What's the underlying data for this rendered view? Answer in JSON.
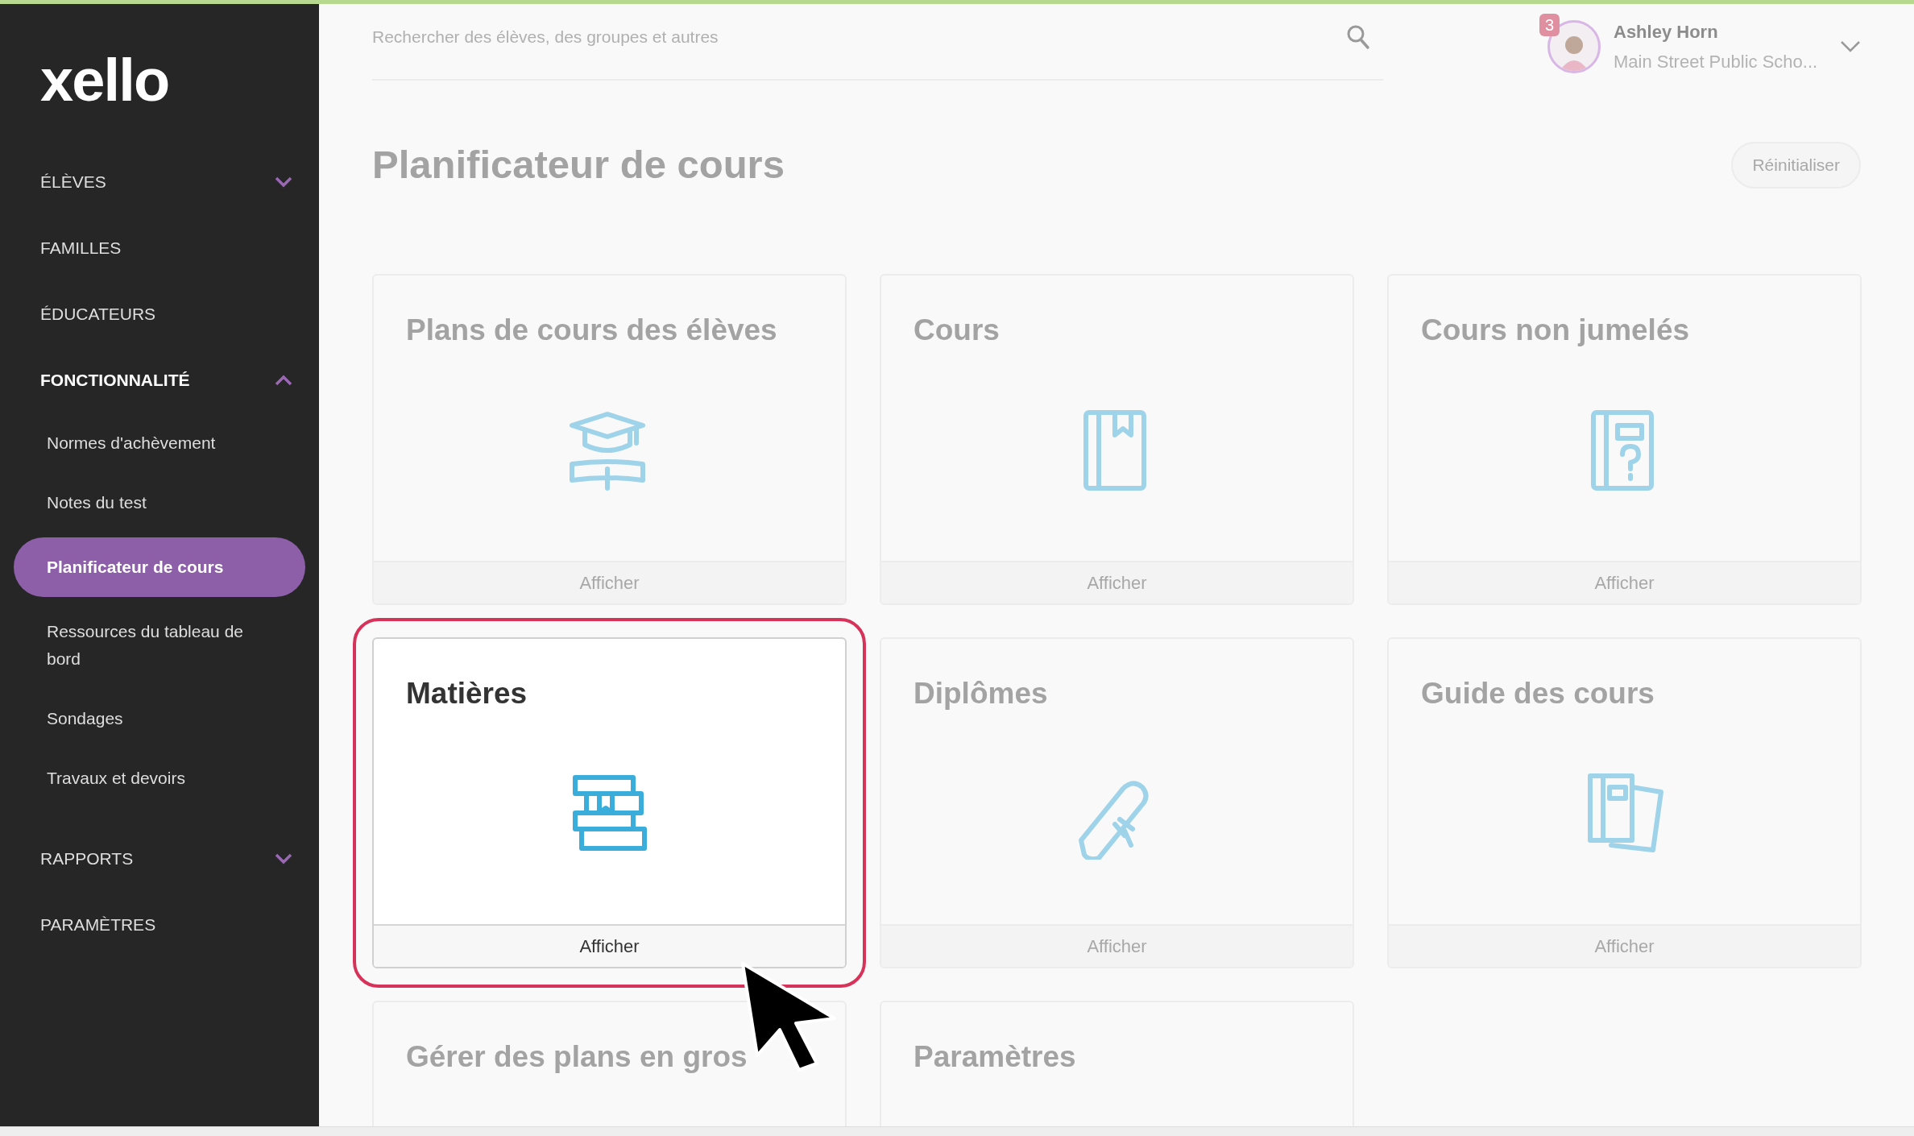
{
  "logo": "xello",
  "sidebar": {
    "items": [
      {
        "label": "ÉLÈVES",
        "expanded": false,
        "has_toggle": true
      },
      {
        "label": "FAMILLES",
        "expanded": false,
        "has_toggle": false
      },
      {
        "label": "ÉDUCATEURS",
        "expanded": false,
        "has_toggle": false
      },
      {
        "label": "FONCTIONNALITÉ",
        "expanded": true,
        "has_toggle": true,
        "children": [
          {
            "label": "Normes d'achèvement",
            "selected": false
          },
          {
            "label": "Notes du test",
            "selected": false
          },
          {
            "label": "Planificateur de cours",
            "selected": true
          },
          {
            "label": "Ressources du tableau de bord",
            "selected": false
          },
          {
            "label": "Sondages",
            "selected": false
          },
          {
            "label": "Travaux et devoirs",
            "selected": false
          }
        ]
      },
      {
        "label": "RAPPORTS",
        "expanded": false,
        "has_toggle": true
      },
      {
        "label": "PARAMÈTRES",
        "expanded": false,
        "has_toggle": false
      }
    ]
  },
  "search": {
    "placeholder": "Rechercher des élèves, des groupes et autres"
  },
  "user": {
    "notification_count": "3",
    "name": "Ashley Horn",
    "school": "Main Street Public Scho..."
  },
  "page_title": "Planificateur de cours",
  "reset_button": "Réinitialiser",
  "cards": [
    {
      "title": "Plans de cours des élèves",
      "footer": "Afficher",
      "highlighted": false
    },
    {
      "title": "Cours",
      "footer": "Afficher",
      "highlighted": false
    },
    {
      "title": "Cours non jumelés",
      "footer": "Afficher",
      "highlighted": false
    },
    {
      "title": "Matières",
      "footer": "Afficher",
      "highlighted": true
    },
    {
      "title": "Diplômes",
      "footer": "Afficher",
      "highlighted": false
    },
    {
      "title": "Guide des cours",
      "footer": "Afficher",
      "highlighted": false
    },
    {
      "title": "Gérer des plans en gros",
      "highlighted": false
    },
    {
      "title": "Paramètres",
      "highlighted": false
    }
  ]
}
